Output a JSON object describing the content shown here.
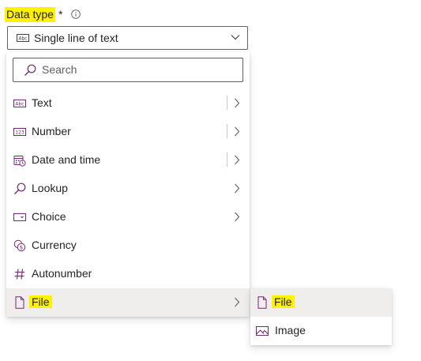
{
  "field": {
    "label": "Data type",
    "required_mark": "*",
    "info_icon": "info-icon"
  },
  "dropdown": {
    "selected_value": "Single line of text",
    "icon": "text-abc-icon",
    "chevron": "chevron-down-icon"
  },
  "menu": {
    "search_placeholder": "Search",
    "items": [
      {
        "label": "Text",
        "icon": "text-abc-icon",
        "has_submenu": true,
        "split": true
      },
      {
        "label": "Number",
        "icon": "number-123-icon",
        "has_submenu": true,
        "split": true
      },
      {
        "label": "Date and time",
        "icon": "calendar-clock-icon",
        "has_submenu": true,
        "split": true
      },
      {
        "label": "Lookup",
        "icon": "search-icon",
        "has_submenu": true,
        "split": false
      },
      {
        "label": "Choice",
        "icon": "choice-icon",
        "has_submenu": true,
        "split": false
      },
      {
        "label": "Currency",
        "icon": "currency-icon",
        "has_submenu": false,
        "split": false
      },
      {
        "label": "Autonumber",
        "icon": "hash-icon",
        "has_submenu": false,
        "split": false
      },
      {
        "label": "File",
        "icon": "document-icon",
        "has_submenu": true,
        "split": false,
        "hovered": true
      }
    ]
  },
  "submenu": {
    "items": [
      {
        "label": "File",
        "icon": "document-icon",
        "hovered": true
      },
      {
        "label": "Image",
        "icon": "image-icon"
      }
    ]
  },
  "colors": {
    "highlight": "#fff200",
    "accent": "#742774",
    "hover_bg": "#f0eeed",
    "border": "#616161"
  }
}
